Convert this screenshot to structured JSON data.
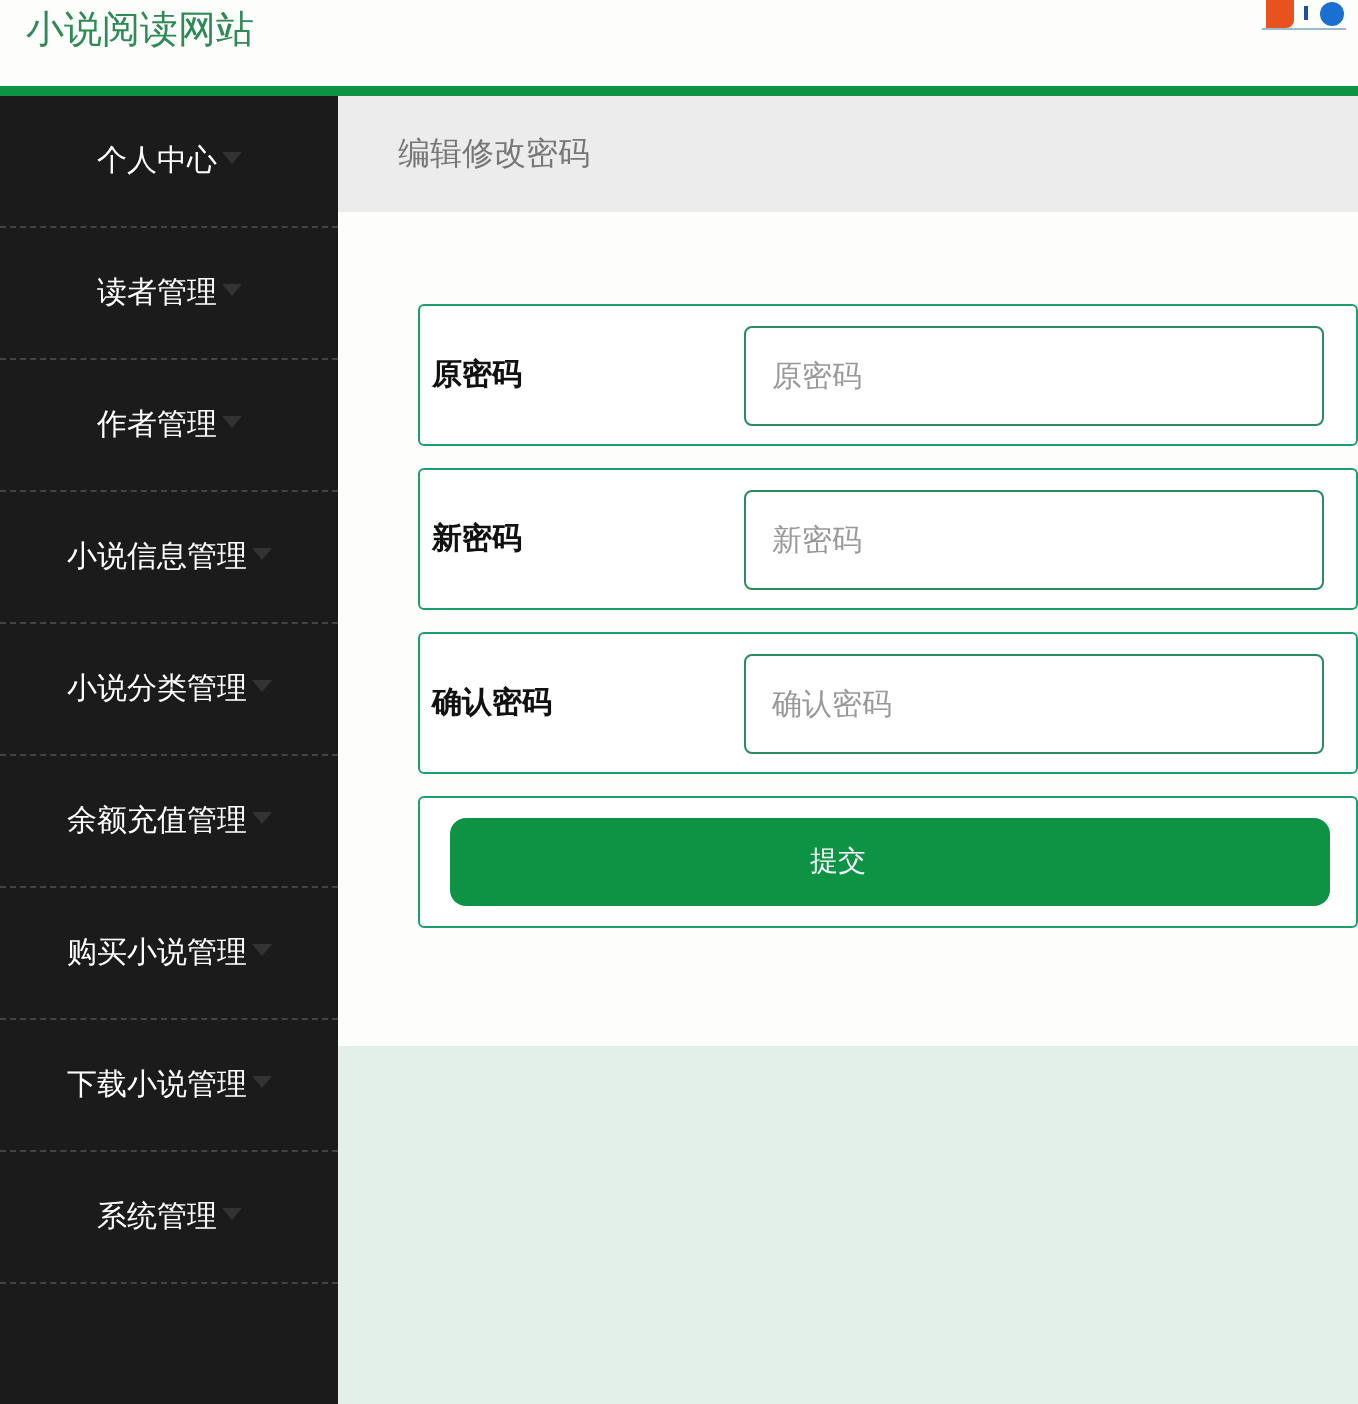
{
  "header": {
    "title": "小说阅读网站"
  },
  "sidebar": {
    "items": [
      {
        "label": "个人中心",
        "expanded": false
      },
      {
        "label": "读者管理",
        "expanded": false
      },
      {
        "label": "作者管理",
        "expanded": false
      },
      {
        "label": "小说信息管理",
        "expanded": false
      },
      {
        "label": "小说分类管理",
        "expanded": false
      },
      {
        "label": "余额充值管理",
        "expanded": false
      },
      {
        "label": "购买小说管理",
        "expanded": false
      },
      {
        "label": "下载小说管理",
        "expanded": false
      },
      {
        "label": "系统管理",
        "expanded": false
      }
    ]
  },
  "breadcrumb": "编辑修改密码",
  "form": {
    "fields": [
      {
        "label": "原密码",
        "placeholder": "原密码"
      },
      {
        "label": "新密码",
        "placeholder": "新密码"
      },
      {
        "label": "确认密码",
        "placeholder": "确认密码"
      }
    ],
    "submit": "提交"
  }
}
